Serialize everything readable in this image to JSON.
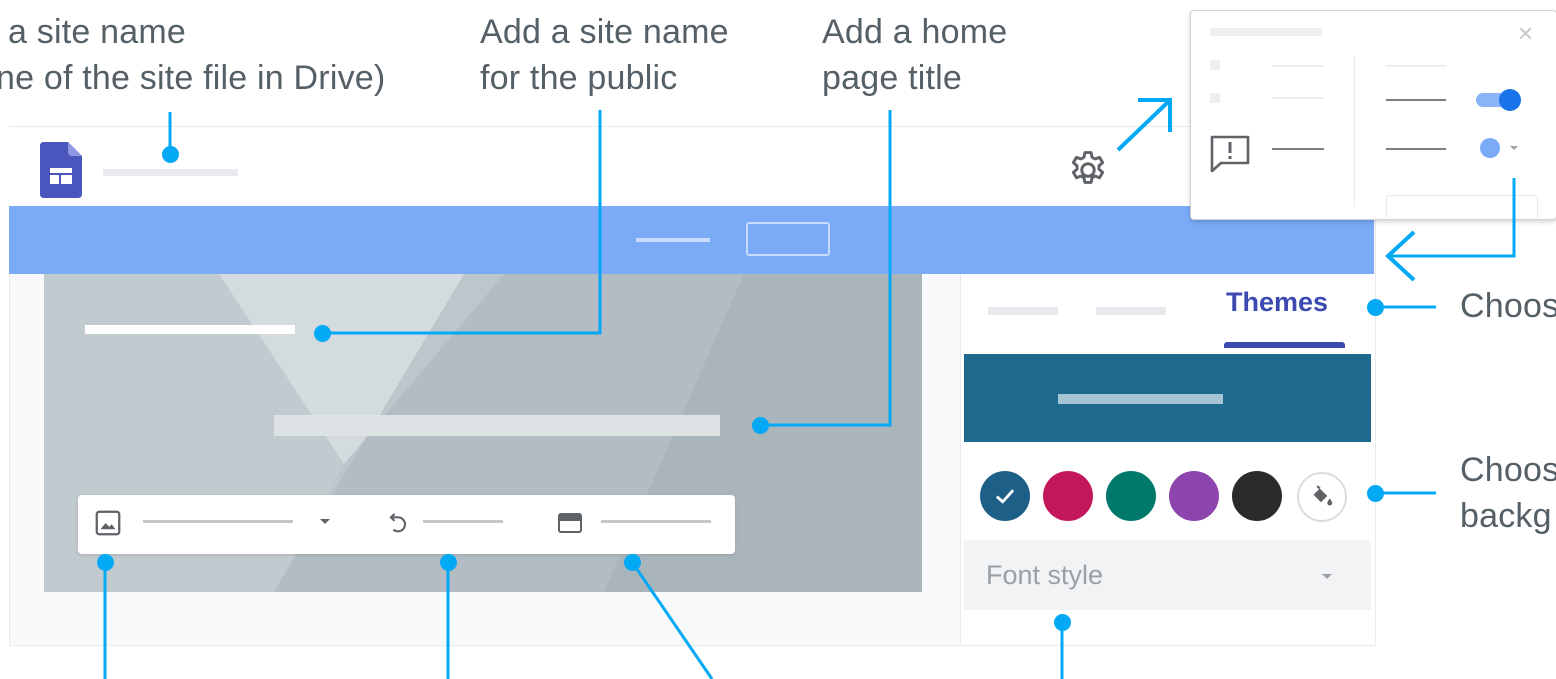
{
  "callouts": {
    "site_name_line1": "a site name",
    "site_name_line2": "ne of the site file in Drive)",
    "public_name_line1": "Add a site name",
    "public_name_line2": "for the public",
    "home_title_line1": "Add a home",
    "home_title_line2": "page title",
    "choose_tab": "Choos",
    "choose_bg_line1": "Choos",
    "choose_bg_line2": "backg"
  },
  "sidebar": {
    "active_tab": "Themes",
    "font_style_placeholder": "Font style",
    "swatches": [
      "#1e5f88",
      "#c2185b",
      "#00796b",
      "#8e44ad",
      "#2b2b2b"
    ]
  },
  "popup": {
    "close_glyph": "×"
  },
  "colors": {
    "accent_blue": "#7baaf7",
    "callout_line": "#03a9f4",
    "themes_tab": "#3c4ab0",
    "theme_preview": "#1e6a8e",
    "sites_logo": "#4a55bd"
  },
  "icons": [
    "sites-logo-icon",
    "settings-gear-icon",
    "feedback-icon",
    "image-icon",
    "undo-icon",
    "layout-icon",
    "dropdown-arrow-icon",
    "paint-bucket-icon",
    "checkmark-icon",
    "close-icon",
    "toggle-icon"
  ]
}
